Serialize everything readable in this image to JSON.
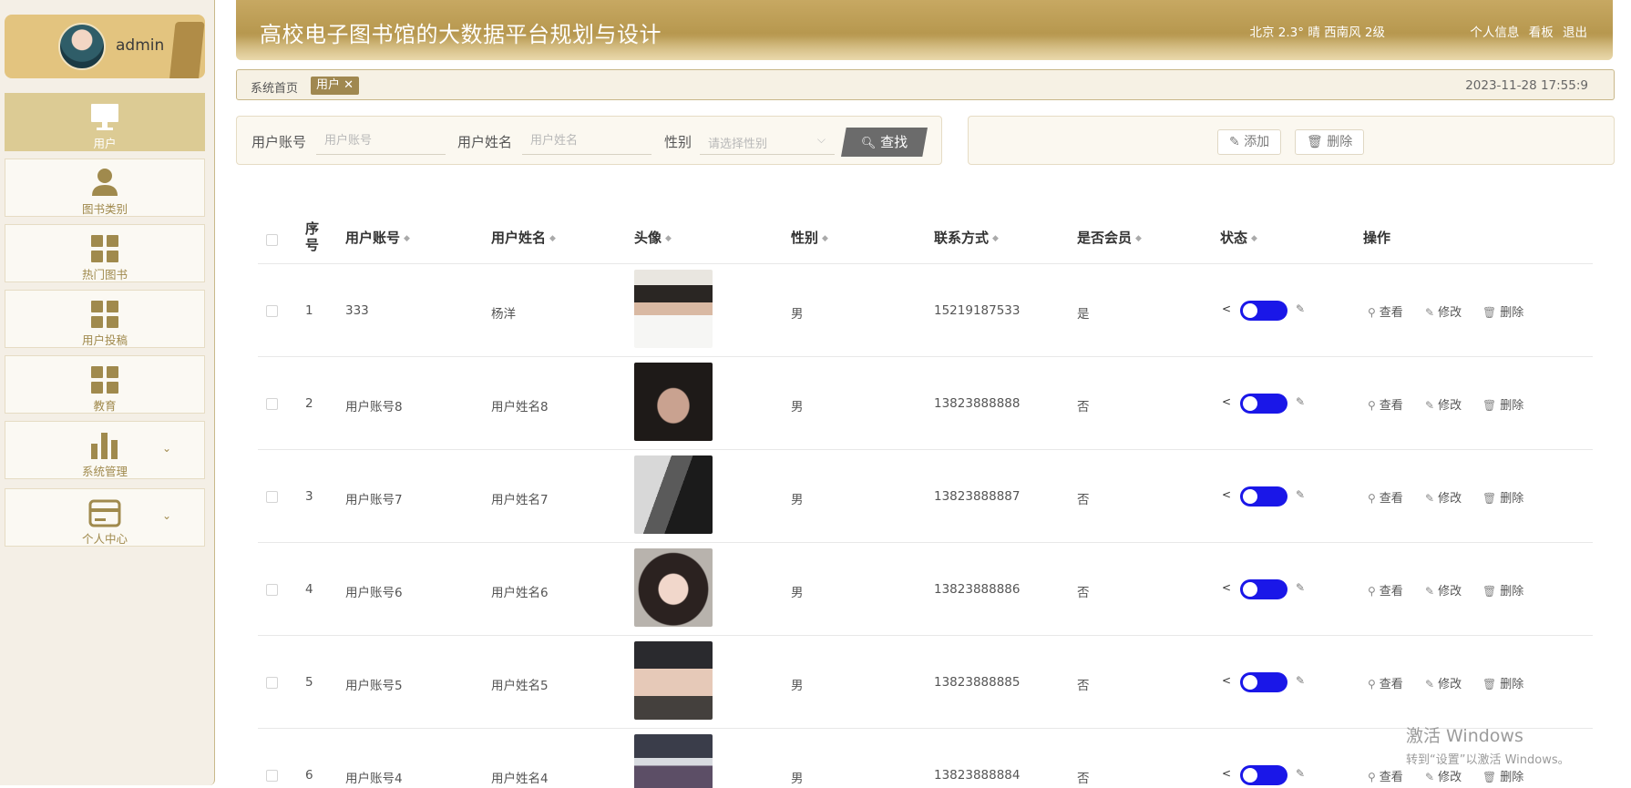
{
  "user": {
    "name": "admin"
  },
  "nav": [
    {
      "label": "用户",
      "icon": "monitor-icon",
      "active": true
    },
    {
      "label": "图书类别",
      "icon": "person-icon"
    },
    {
      "label": "热门图书",
      "icon": "grid-icon"
    },
    {
      "label": "用户投稿",
      "icon": "grid-icon"
    },
    {
      "label": "教育",
      "icon": "grid-icon"
    },
    {
      "label": "系统管理",
      "icon": "bar-chart-icon",
      "chevron": "⌄"
    },
    {
      "label": "个人中心",
      "icon": "wallet-icon",
      "chevron": "⌄"
    }
  ],
  "header": {
    "title": "高校电子图书馆的大数据平台规划与设计",
    "weather": "北京  2.3°  晴  西南风  2级",
    "links": [
      "个人信息",
      "看板",
      "退出"
    ]
  },
  "breadcrumb": {
    "home": "系统首页",
    "tag": "用户 ✕",
    "time": "2023-11-28 17:55:9"
  },
  "search": {
    "account_label": "用户账号",
    "account_placeholder": "用户账号",
    "name_label": "用户姓名",
    "name_placeholder": "用户姓名",
    "gender_label": "性别",
    "gender_placeholder": "请选择性别",
    "button": "查找"
  },
  "actions": {
    "add": "添加",
    "delete": "删除"
  },
  "table": {
    "headers": {
      "index": "序号",
      "account": "用户账号",
      "name": "用户姓名",
      "avatar": "头像",
      "gender": "性别",
      "phone": "联系方式",
      "member": "是否会员",
      "status": "状态",
      "ops": "操作"
    },
    "ops": {
      "view": "查看",
      "edit": "修改",
      "delete": "删除"
    },
    "rows": [
      {
        "index": "1",
        "account": "333",
        "name": "杨洋",
        "gender": "男",
        "phone": "15219187533",
        "member": "是"
      },
      {
        "index": "2",
        "account": "用户账号8",
        "name": "用户姓名8",
        "gender": "男",
        "phone": "13823888888",
        "member": "否"
      },
      {
        "index": "3",
        "account": "用户账号7",
        "name": "用户姓名7",
        "gender": "男",
        "phone": "13823888887",
        "member": "否"
      },
      {
        "index": "4",
        "account": "用户账号6",
        "name": "用户姓名6",
        "gender": "男",
        "phone": "13823888886",
        "member": "否"
      },
      {
        "index": "5",
        "account": "用户账号5",
        "name": "用户姓名5",
        "gender": "男",
        "phone": "13823888885",
        "member": "否"
      },
      {
        "index": "6",
        "account": "用户账号4",
        "name": "用户姓名4",
        "gender": "男",
        "phone": "13823888884",
        "member": "否"
      }
    ]
  },
  "watermark": {
    "line1": "激活 Windows",
    "line2": "转到“设置”以激活 Windows。"
  },
  "colors": {
    "accent": "#a08850",
    "header": "#c7a862",
    "toggle_on": "#1a17e8"
  }
}
